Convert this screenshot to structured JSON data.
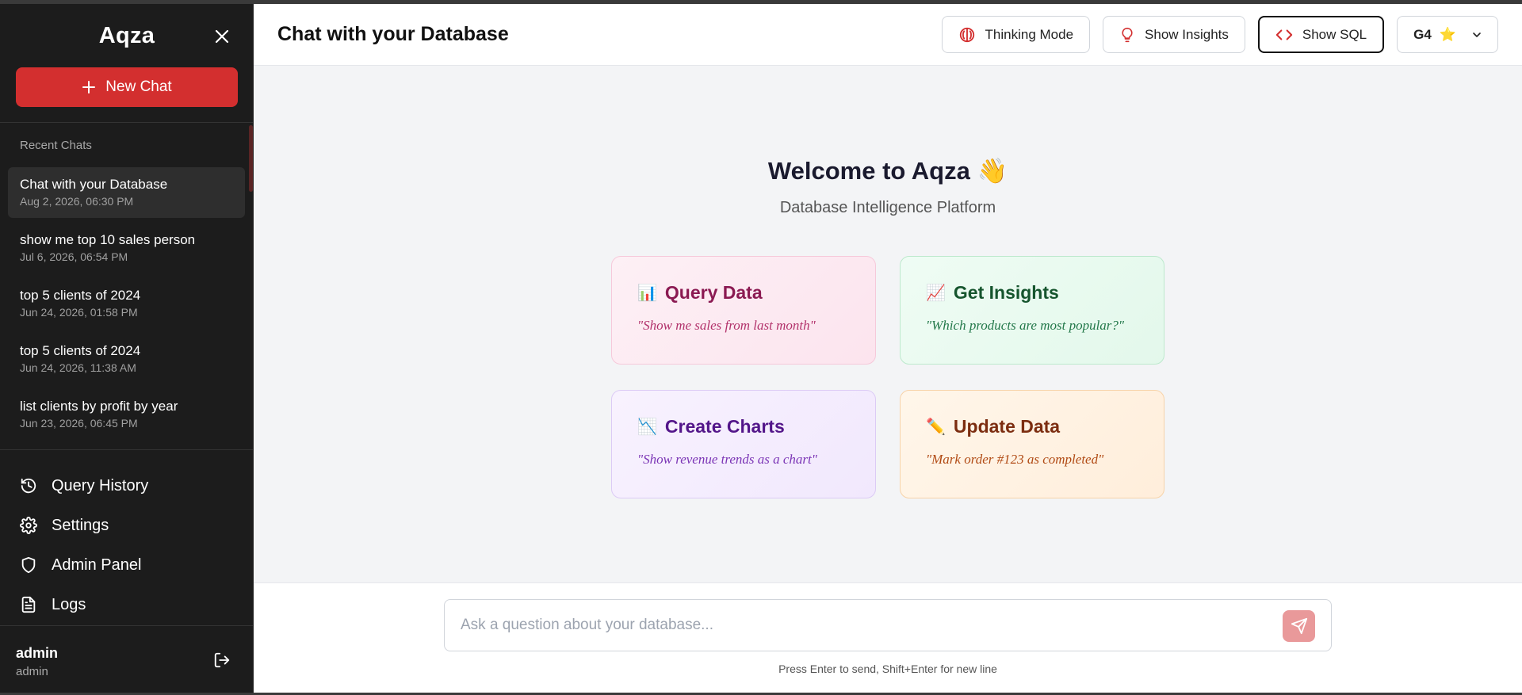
{
  "sidebar": {
    "brand": "Aqza",
    "new_chat_label": "New Chat",
    "recent_label": "Recent Chats",
    "chats": [
      {
        "title": "Chat with your Database",
        "date": "Aug 2, 2026, 06:30 PM"
      },
      {
        "title": "show me top 10 sales person",
        "date": "Jul 6, 2026, 06:54 PM"
      },
      {
        "title": "top 5 clients of 2024",
        "date": "Jun 24, 2026, 01:58 PM"
      },
      {
        "title": "top 5 clients of 2024",
        "date": "Jun 24, 2026, 11:38 AM"
      },
      {
        "title": "list clients by profit by year",
        "date": "Jun 23, 2026, 06:45 PM"
      }
    ],
    "nav": [
      {
        "label": "Query History",
        "icon": "history-icon"
      },
      {
        "label": "Settings",
        "icon": "gear-icon"
      },
      {
        "label": "Admin Panel",
        "icon": "shield-icon"
      },
      {
        "label": "Logs",
        "icon": "file-text-icon"
      }
    ],
    "user": {
      "name": "admin",
      "role": "admin"
    }
  },
  "header": {
    "title": "Chat with your Database",
    "thinking_label": "Thinking Mode",
    "insights_label": "Show Insights",
    "sql_label": "Show SQL",
    "model_label": "G4",
    "model_badge": "⭐"
  },
  "welcome": {
    "title": "Welcome to Aqza 👋",
    "subtitle": "Database Intelligence Platform",
    "cards": [
      {
        "emoji": "📊",
        "title": "Query Data",
        "example": "\"Show me sales from last month\""
      },
      {
        "emoji": "📈",
        "title": "Get Insights",
        "example": "\"Which products are most popular?\""
      },
      {
        "emoji": "📉",
        "title": "Create Charts",
        "example": "\"Show revenue trends as a chart\""
      },
      {
        "emoji": "✏️",
        "title": "Update Data",
        "example": "\"Mark order #123 as completed\""
      }
    ]
  },
  "composer": {
    "placeholder": "Ask a question about your database...",
    "hint": "Press Enter to send, Shift+Enter for new line"
  },
  "colors": {
    "accent": "#d32f2f",
    "sidebar_bg": "#1c1c1c",
    "send_button": "#e9999a"
  }
}
